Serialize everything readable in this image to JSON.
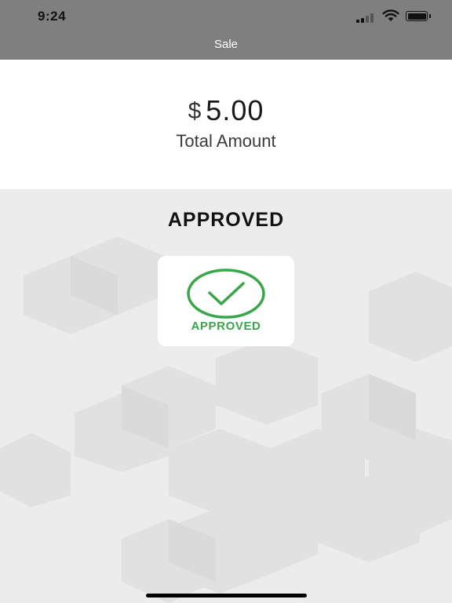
{
  "status_bar": {
    "time": "9:24"
  },
  "nav": {
    "title": "Sale"
  },
  "amount_panel": {
    "currency_symbol": "$",
    "amount": "5.00",
    "label": "Total Amount"
  },
  "result": {
    "title": "APPROVED",
    "card_label": "APPROVED"
  },
  "colors": {
    "header_bg": "#7f7f7f",
    "approved_green": "#3aa64a",
    "page_bg": "#ececec"
  },
  "icons": [
    "cellular-signal-icon",
    "wifi-icon",
    "battery-icon",
    "checkmark-circle-icon"
  ]
}
